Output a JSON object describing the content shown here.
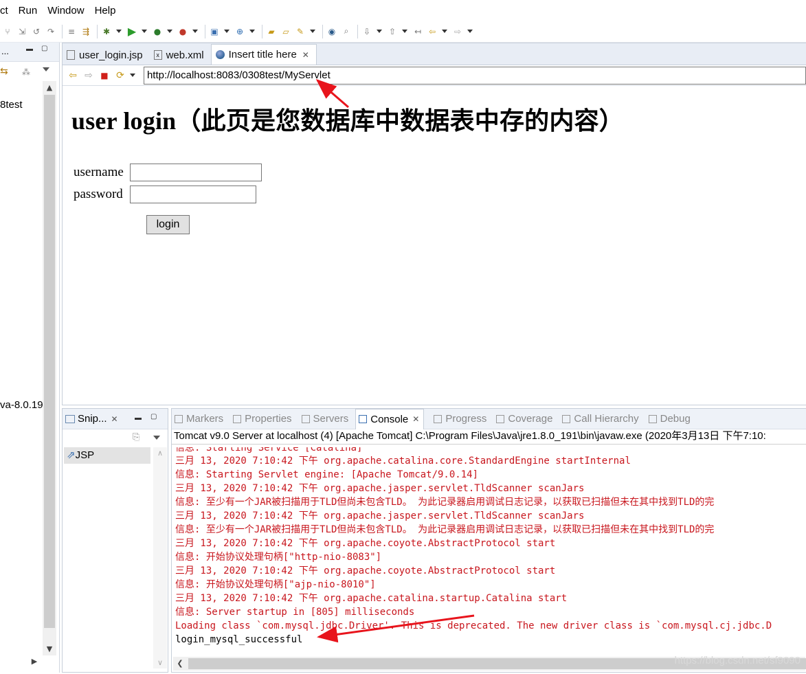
{
  "menu": {
    "item0": "ct",
    "item1": "Run",
    "item2": "Window",
    "item3": "Help"
  },
  "left_panel": {
    "title": "...",
    "project_text": "8test",
    "jar_text": "va-8.0.19"
  },
  "editor": {
    "tabs": [
      {
        "label": "user_login.jsp"
      },
      {
        "label": "web.xml"
      },
      {
        "label": "Insert title here"
      }
    ],
    "url": "http://localhost:8083/0308test/MyServlet"
  },
  "page": {
    "heading": "user login（此页是您数据库中数据表中存的内容）",
    "username_label": "username",
    "password_label": "password",
    "login_button": "login"
  },
  "snippets": {
    "tab_label": "Snip...",
    "item": "JSP"
  },
  "console": {
    "tabs": [
      "Markers",
      "Properties",
      "Servers",
      "Console",
      "Progress",
      "Coverage",
      "Call Hierarchy",
      "Debug"
    ],
    "active_tab": "Console",
    "header": "Tomcat v9.0 Server at localhost (4) [Apache Tomcat] C:\\Program Files\\Java\\jre1.8.0_191\\bin\\javaw.exe (2020年3月13日 下午7:10:",
    "partial_line": "信息: Starting Service [Catalina]",
    "lines": [
      "三月 13, 2020 7:10:42 下午 org.apache.catalina.core.StandardEngine startInternal",
      "信息: Starting Servlet engine: [Apache Tomcat/9.0.14]",
      "三月 13, 2020 7:10:42 下午 org.apache.jasper.servlet.TldScanner scanJars",
      "信息: 至少有一个JAR被扫描用于TLD但尚未包含TLD。 为此记录器启用调试日志记录，以获取已扫描但未在其中找到TLD的完",
      "三月 13, 2020 7:10:42 下午 org.apache.jasper.servlet.TldScanner scanJars",
      "信息: 至少有一个JAR被扫描用于TLD但尚未包含TLD。 为此记录器启用调试日志记录，以获取已扫描但未在其中找到TLD的完",
      "三月 13, 2020 7:10:42 下午 org.apache.coyote.AbstractProtocol start",
      "信息: 开始协议处理句柄[\"http-nio-8083\"]",
      "三月 13, 2020 7:10:42 下午 org.apache.coyote.AbstractProtocol start",
      "信息: 开始协议处理句柄[\"ajp-nio-8010\"]",
      "三月 13, 2020 7:10:42 下午 org.apache.catalina.startup.Catalina start",
      "信息: Server startup in [805] milliseconds",
      "Loading class `com.mysql.jdbc.Driver'. This is deprecated. The new driver class is `com.mysql.cj.jdbc.D"
    ],
    "success_line": "login_mysql_successful",
    "watermark": "https://blog.csdn.net/sf9090"
  },
  "colors": {
    "error_text": "#c8161d",
    "annotation_arrow": "#e8141c"
  }
}
